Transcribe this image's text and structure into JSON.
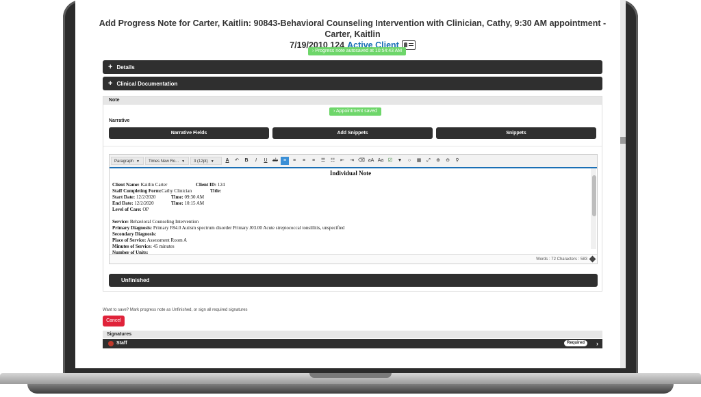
{
  "header": {
    "title_line1": "Add Progress Note for Carter, Kaitlin: 90843-Behavioral Counseling Intervention with Clinician, Cathy, 9:30 AM appointment - Carter, Kaitlin",
    "title_line2": "7/19/2010 124",
    "active_client": "Active Client",
    "autosave_message": "› Progress note autosaved at 10:54:43 AM"
  },
  "accordions": {
    "details": "Details",
    "clinical": "Clinical Documentation"
  },
  "note": {
    "header": "Note",
    "appointment_saved": "› Appointment saved",
    "narrative_label": "Narrative",
    "buttons": {
      "fields": "Narrative Fields",
      "add_snippets": "Add Snippets",
      "snippets": "Snippets"
    }
  },
  "toolbar": {
    "format": "Paragraph",
    "font": "Times New Ro...",
    "size": "3 (12pt)"
  },
  "document": {
    "title": "Individual Note",
    "client_name_label": "Client Name:",
    "client_name": "Kaitlin Carter",
    "client_id_label": "Client ID:",
    "client_id": "124",
    "staff_label": "Staff Completing Form:",
    "staff": "Cathy Clinician",
    "title_label": "Title:",
    "start_date_label": "Start Date:",
    "start_date": "12/2/2020",
    "time_label": "Time:",
    "start_time": "09:30 AM",
    "end_date_label": "End Date:",
    "end_date": "12/2/2020",
    "end_time": "10:15 AM",
    "level_label": "Level of Care:",
    "level": "OP",
    "service_label": "Service:",
    "service": "Behavioral Counseling Intervention",
    "primary_dx_label": "Primary Diagnosis:",
    "primary_dx": "Primary F84.0 Autism spectrum disorder Primary J03.00 Acute streptococcal tonsillitis, unspecified",
    "secondary_dx_label": "Secondary Diagnosis:",
    "place_label": "Place of Service:",
    "place": "Assessment Room A",
    "minutes_label": "Minutes of Service:",
    "minutes": "45 minutes",
    "units_label": "Number of Units:"
  },
  "editor_status": "Words : 72   Characters : 583",
  "status_bar": {
    "unfinished": "Unfinished"
  },
  "footer": {
    "hint": "Want to save? Mark progress note as Unfinished, or sign all required signatures",
    "cancel": "Cancel",
    "signatures": "Signatures",
    "staff": "Staff",
    "required": "Required"
  },
  "colors": {
    "bar": "#2f2f2f",
    "accent": "#1a6fb5",
    "toast": "#6ed66a",
    "cancel": "#e0233a"
  }
}
